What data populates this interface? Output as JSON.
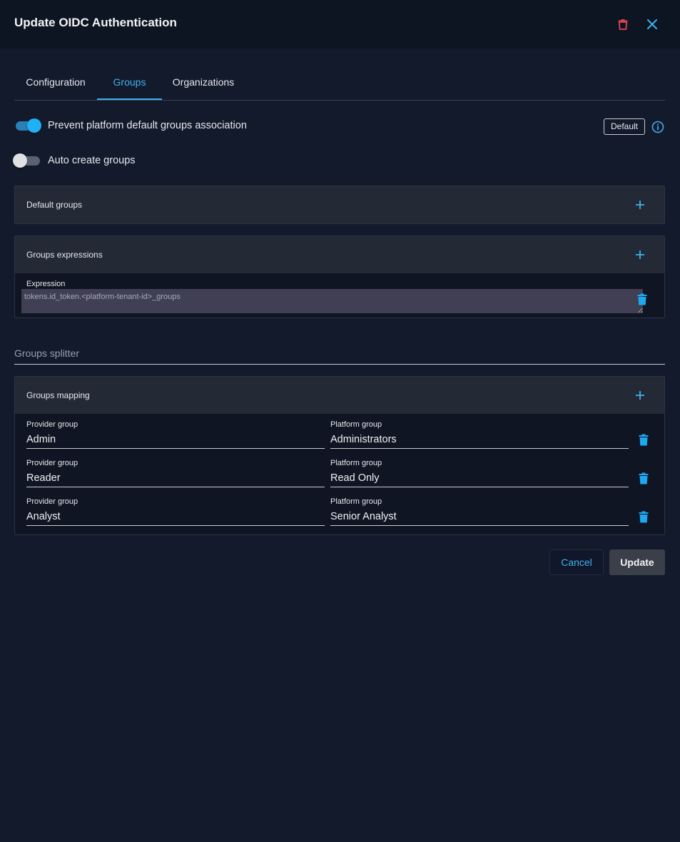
{
  "header": {
    "title": "Update OIDC Authentication",
    "colors": {
      "delete": "#e0454f",
      "close": "#41b0ef"
    }
  },
  "tabs": [
    {
      "label": "Configuration",
      "active": false
    },
    {
      "label": "Groups",
      "active": true
    },
    {
      "label": "Organizations",
      "active": false
    }
  ],
  "toggles": {
    "prevent_default": {
      "label": "Prevent platform default groups association",
      "on": true
    },
    "auto_create": {
      "label": "Auto create groups",
      "on": false
    }
  },
  "badge": {
    "label": "Default"
  },
  "default_groups": {
    "title": "Default groups"
  },
  "groups_expressions": {
    "title": "Groups expressions",
    "expression_label": "Expression",
    "expression_value": "tokens.id_token.<platform-tenant-id>_groups"
  },
  "groups_splitter": {
    "placeholder": "Groups splitter",
    "value": ""
  },
  "groups_mapping": {
    "title": "Groups mapping",
    "provider_label": "Provider group",
    "platform_label": "Platform group",
    "rows": [
      {
        "provider": "Admin",
        "platform": "Administrators"
      },
      {
        "provider": "Reader",
        "platform": "Read Only"
      },
      {
        "provider": "Analyst",
        "platform": "Senior Analyst"
      }
    ]
  },
  "actions": {
    "cancel": "Cancel",
    "update": "Update"
  },
  "colors": {
    "accent": "#41b0ef",
    "background": "#121a2b"
  }
}
